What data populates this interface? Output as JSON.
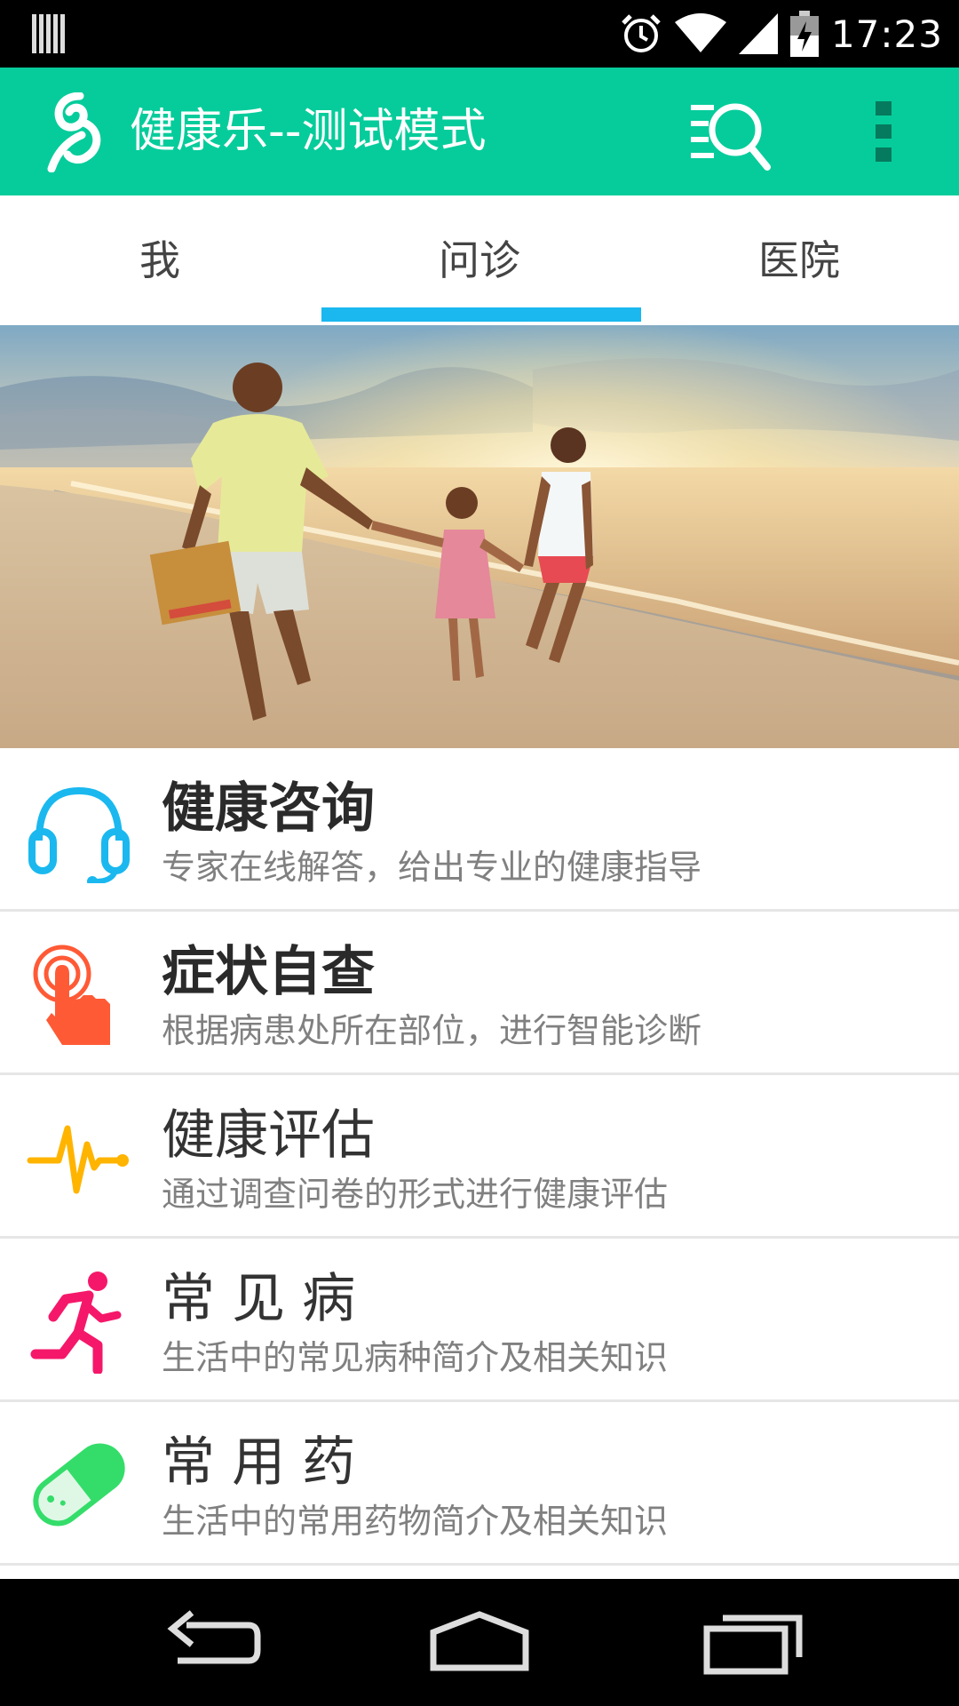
{
  "status_bar": {
    "time": "17:23",
    "icons": [
      "barcode-icon",
      "alarm-icon",
      "wifi-icon",
      "signal-icon",
      "battery-icon"
    ]
  },
  "app_bar": {
    "title": "健康乐--测试模式",
    "background_color": "#06cc9b",
    "icons": [
      "app-logo-icon",
      "search-list-icon",
      "overflow-menu-icon"
    ]
  },
  "tabs": {
    "items": [
      {
        "label": "我",
        "selected": false
      },
      {
        "label": "问诊",
        "selected": true
      },
      {
        "label": "医院",
        "selected": false
      }
    ],
    "indicator_color": "#1ab8ef"
  },
  "banner": {
    "image": "family-on-beach-at-sunset"
  },
  "features": [
    {
      "title": "健康咨询",
      "description": "专家在线解答，给出专业的健康指导",
      "icon": "headset-icon",
      "color": "#1ab8ef",
      "bold": true
    },
    {
      "title": "症状自查",
      "description": "根据病患处所在部位，进行智能诊断",
      "icon": "finger-tap-icon",
      "color": "#ff5a36",
      "bold": true
    },
    {
      "title": "健康评估",
      "description": "通过调查问卷的形式进行健康评估",
      "icon": "heartbeat-icon",
      "color": "#ffb400",
      "bold": false
    },
    {
      "title": "常 见 病",
      "description": "生活中的常见病种简介及相关知识",
      "icon": "running-person-icon",
      "color": "#f5186a",
      "bold": false
    },
    {
      "title": "常 用 药",
      "description": "生活中的常用药物简介及相关知识",
      "icon": "pill-capsule-icon",
      "color": "#34dd6a",
      "bold": false
    }
  ],
  "nav_bar": {
    "icons": [
      "back-icon",
      "home-icon",
      "recent-apps-icon"
    ]
  }
}
